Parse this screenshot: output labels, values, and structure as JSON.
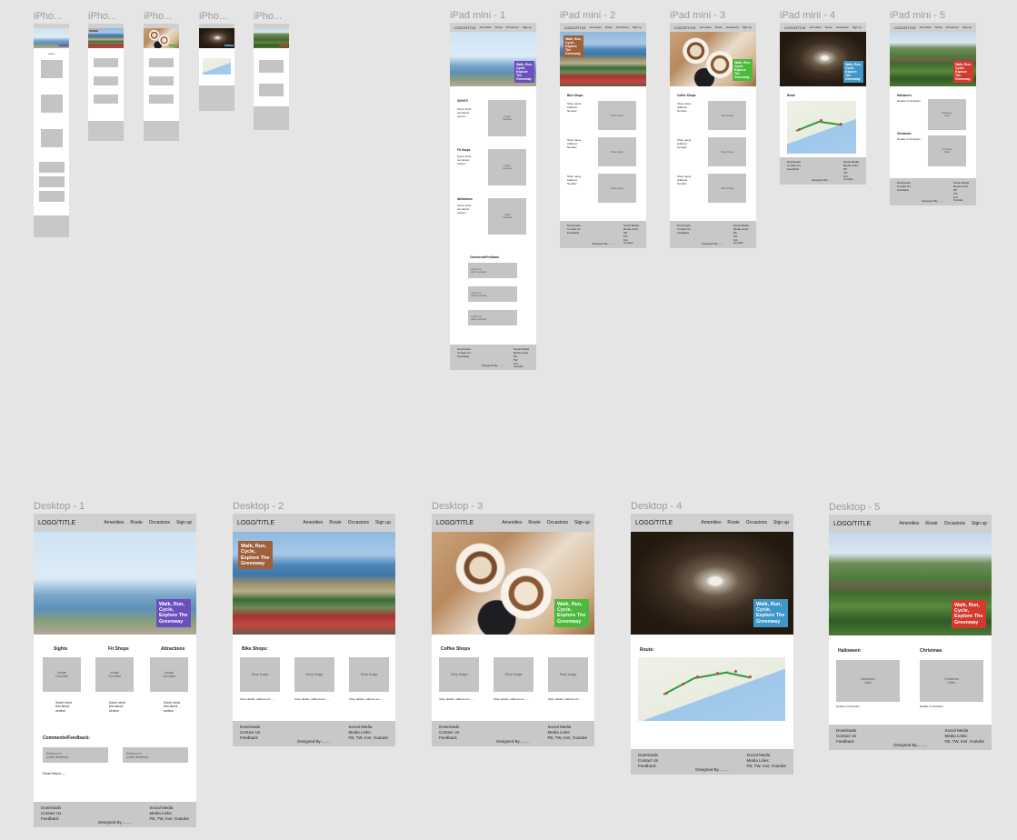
{
  "site": {
    "logo": "LOGO/TITLE",
    "nav": [
      "Amenities",
      "Route",
      "Occasions",
      "Sign up"
    ],
    "cta": "Walk, Run, Cycle, Explore The Greenway",
    "footer_left": "Downloads\nContact Us\nFeedback",
    "footer_right_desktop": "Social Media\nMedia Links:\nFB, TW, Inst ,Youtube",
    "footer_right_mobile": "Social Media\nMedia Links:\nFB\nTW\nInst\nYoutube",
    "designed_by": "Designed By.........",
    "cta_colors": {
      "purple": "#6b4fbf",
      "brown": "#a0603a",
      "green": "#4cb83c",
      "blue": "#3f96c8",
      "red": "#d23a2d"
    }
  },
  "frames": {
    "iphone": [
      "iPho...",
      "iPho...",
      "iPho...",
      "iPho...",
      "iPho..."
    ],
    "ipad": [
      "iPad mini - 1",
      "iPad mini - 2",
      "iPad mini - 3",
      "iPad mini - 4",
      "iPad mini - 5"
    ],
    "desktop": [
      "Desktop - 1",
      "Desktop - 2",
      "Desktop - 3",
      "Desktop - 4",
      "Desktop - 5"
    ]
  },
  "home": {
    "sections": [
      "Sights",
      "Fit Shops",
      "Attractions"
    ],
    "image_carousel": "Image\nCarousel",
    "section_text": "Some short\ntext about\nsection",
    "comments_heading": "Comments/Feedback:",
    "feedback_item": "Section on\npublic feedback",
    "read_more": "Read More......"
  },
  "ipad_home": {
    "sections": [
      "SIGHTS",
      "Fit Shops",
      "Attractions"
    ],
    "section_text": "Some short\ntext about\nsection",
    "comments_heading": "Comments/Feedback"
  },
  "shops": {
    "bike_heading": "Bike Shops:",
    "coffee_heading": "Coffee Shops",
    "shop_image": "Shop Image",
    "shop_details": "Shop details, address etc......",
    "ipad_bike_heading": "Bike Shops",
    "ipad_shop_text": "Shop name\nAddress\nNumber"
  },
  "route": {
    "heading": "Route:",
    "ipad_heading": "Route"
  },
  "occasions": {
    "halloween": "Halloween",
    "christmas": "Christmas",
    "halloween_video": "Halloween\nVideo",
    "christmas_video": "Christmas\nVideo",
    "details": "Details of Occasion"
  }
}
